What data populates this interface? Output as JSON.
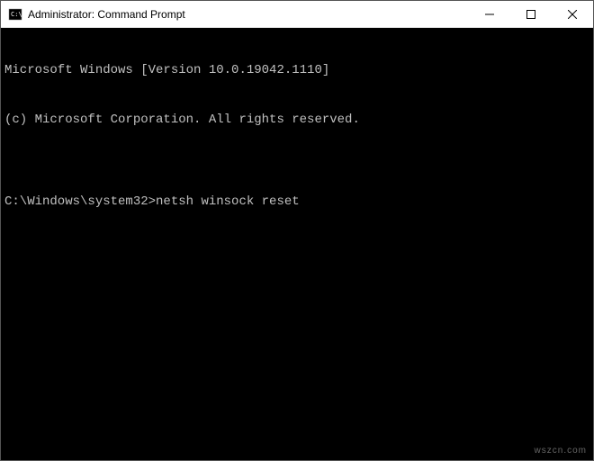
{
  "window": {
    "title": "Administrator: Command Prompt"
  },
  "terminal": {
    "line1": "Microsoft Windows [Version 10.0.19042.1110]",
    "line2": "(c) Microsoft Corporation. All rights reserved.",
    "blank": "",
    "prompt": "C:\\Windows\\system32>",
    "command": "netsh winsock reset"
  },
  "watermark": "wszcn.com"
}
